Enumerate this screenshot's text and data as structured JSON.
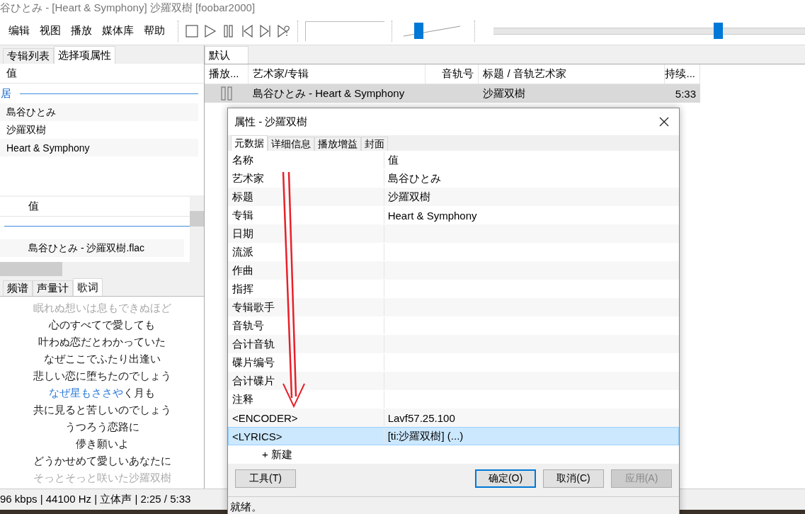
{
  "window": {
    "title": "谷ひとみ - [Heart & Symphony] 沙羅双樹  [foobar2000]"
  },
  "menu": [
    "编辑",
    "视图",
    "播放",
    "媒体库",
    "帮助"
  ],
  "toolbar": {
    "buttons": [
      {
        "kind": "stop"
      },
      {
        "kind": "play"
      },
      {
        "kind": "pause"
      },
      {
        "kind": "prev"
      },
      {
        "kind": "next"
      },
      {
        "kind": "random"
      }
    ],
    "volume": {
      "level": 0.25
    },
    "seek": {
      "level": 0.66
    }
  },
  "left_panel": {
    "tabs": [
      {
        "label": "专辑列表",
        "selected": false
      },
      {
        "label": "选择项属性",
        "selected": true
      }
    ],
    "properties": {
      "header": "值",
      "section": "居",
      "rows": [
        "島谷ひとみ",
        "沙羅双樹",
        "Heart & Symphony"
      ]
    },
    "file_info": {
      "header": "值",
      "rows": [
        "島谷ひとみ - 沙羅双樹.flac"
      ]
    },
    "bottom_tabs": [
      {
        "label": "频谱",
        "selected": false
      },
      {
        "label": "声量计",
        "selected": false
      },
      {
        "label": "歌词",
        "selected": true
      }
    ],
    "lyrics": [
      {
        "text": "眠れぬ想いは息もできぬほど",
        "faded": true
      },
      {
        "text": "心のすべてで愛しても",
        "faded": false
      },
      {
        "text": "叶わぬ恋だとわかっていた",
        "faded": false
      },
      {
        "text": "なぜここでふたり出逢い",
        "faded": false
      },
      {
        "text": "悲しい恋に堕ちたのでしょう",
        "faded": false
      },
      {
        "sung": "なぜ星もささや",
        "text": "く月も",
        "faded": false
      },
      {
        "text": "共に見ると苦しいのでしょう",
        "faded": false
      },
      {
        "text": "うつろう恋路に",
        "faded": false
      },
      {
        "text": "儚き願いよ",
        "faded": false
      },
      {
        "text": "どうかせめて愛しいあなたに",
        "faded": false
      },
      {
        "text": "そっとそっと咲いた沙羅双樹",
        "faded": true
      }
    ]
  },
  "playlist": {
    "tabs": [
      {
        "label": "默认",
        "selected": true
      }
    ],
    "columns": [
      "播放...",
      "艺术家/专辑",
      "音轨号",
      "标题 / 音轨艺术家",
      "持续..."
    ],
    "rows": [
      {
        "playing": true,
        "selected": true,
        "artist_album": "島谷ひとみ - Heart & Symphony",
        "track": "",
        "title": "沙羅双樹",
        "duration": "5:33"
      }
    ]
  },
  "status_bar": "96 kbps | 44100 Hz | 立体声 | 2:25 / 5:33",
  "dialog": {
    "title": "属性 - 沙羅双樹",
    "tabs": [
      {
        "label": "元数据",
        "selected": true
      },
      {
        "label": "详细信息",
        "selected": false
      },
      {
        "label": "播放增益",
        "selected": false
      },
      {
        "label": "封面",
        "selected": false
      }
    ],
    "columns": [
      "名称",
      "值"
    ],
    "rows": [
      {
        "name": "艺术家",
        "value": "島谷ひとみ",
        "selected": false
      },
      {
        "name": "标题",
        "value": "沙羅双樹",
        "selected": false
      },
      {
        "name": "专辑",
        "value": "Heart & Symphony",
        "selected": false
      },
      {
        "name": "日期",
        "value": "",
        "selected": false
      },
      {
        "name": "流派",
        "value": "",
        "selected": false
      },
      {
        "name": "作曲",
        "value": "",
        "selected": false
      },
      {
        "name": "指挥",
        "value": "",
        "selected": false
      },
      {
        "name": "专辑歌手",
        "value": "",
        "selected": false
      },
      {
        "name": "音轨号",
        "value": "",
        "selected": false
      },
      {
        "name": "合计音轨",
        "value": "",
        "selected": false
      },
      {
        "name": "碟片编号",
        "value": "",
        "selected": false
      },
      {
        "name": "合计碟片",
        "value": "",
        "selected": false
      },
      {
        "name": "注释",
        "value": "",
        "selected": false
      },
      {
        "name": "<ENCODER>",
        "value": "Lavf57.25.100",
        "selected": false
      },
      {
        "name": "<LYRICS>",
        "value": "[ti:沙羅双樹] (...)",
        "selected": true
      }
    ],
    "new_row": "+ 新建",
    "buttons": [
      {
        "label": "工具(T)",
        "kind": "normal"
      },
      {
        "label": "确定(O)",
        "kind": "default"
      },
      {
        "label": "取消(C)",
        "kind": "normal"
      },
      {
        "label": "应用(A)",
        "kind": "disabled"
      }
    ],
    "status": "就绪。"
  }
}
